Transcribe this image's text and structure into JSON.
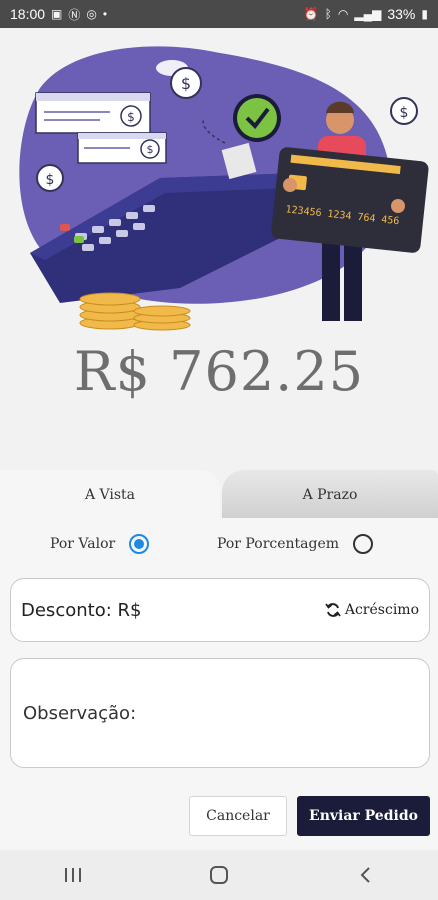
{
  "status_bar": {
    "time": "18:00",
    "left_icons": [
      "gallery-icon",
      "n-notification-icon",
      "whatsapp-icon",
      "dot-icon"
    ],
    "right_icons": [
      "alarm-icon",
      "bluetooth-icon",
      "wifi-icon",
      "signal-icon"
    ],
    "battery": "33%"
  },
  "hero": {
    "card_number": "123456 1234 764 456",
    "illustration": "payment-terminal-illustration"
  },
  "amount": "R$ 762.25",
  "tabs": [
    {
      "label": "A Vista",
      "active": true
    },
    {
      "label": "A Prazo",
      "active": false
    }
  ],
  "discount_mode": {
    "by_value_label": "Por Valor",
    "by_value_selected": true,
    "by_percent_label": "Por Porcentagem",
    "by_percent_selected": false
  },
  "desconto": {
    "label": "Desconto: R$",
    "toggle_label": "Acréscimo"
  },
  "observacao": {
    "label": "Observação:"
  },
  "buttons": {
    "cancel": "Cancelar",
    "send": "Enviar Pedido"
  },
  "nav": [
    "recents-icon",
    "home-icon",
    "back-icon"
  ],
  "colors": {
    "accent": "#1e88e5",
    "primary_button": "#1b1b3a",
    "illustration_purple": "#6a5fb5"
  }
}
